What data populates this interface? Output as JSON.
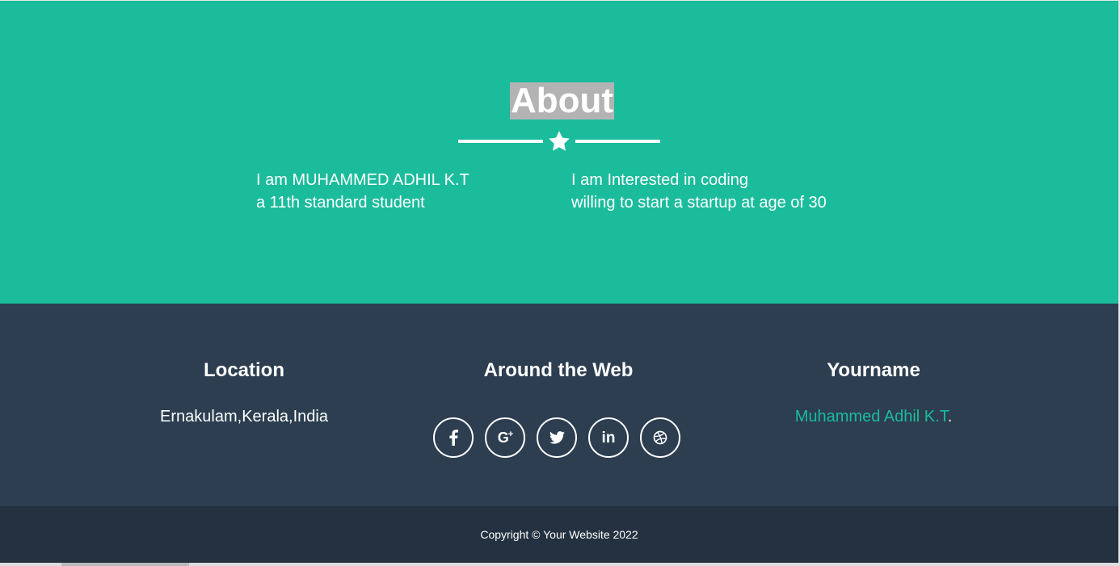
{
  "about": {
    "title": "About",
    "col1": {
      "line1": "I am MUHAMMED ADHIL K.T",
      "line2": "a 11th standard student"
    },
    "col2": {
      "line1": "I am Interested in coding",
      "line2": "willing to start a startup at age of 30"
    },
    "divider_icon": "star-icon"
  },
  "footer": {
    "location": {
      "heading": "Location",
      "text": "Ernakulam,Kerala,India"
    },
    "web": {
      "heading": "Around the Web",
      "socials": [
        "facebook-icon",
        "google-plus-icon",
        "twitter-icon",
        "linkedin-icon",
        "dribbble-icon"
      ]
    },
    "name": {
      "heading": "Yourname",
      "link_text": "Muhammed Adhil K.T",
      "suffix": "."
    },
    "copyright": "Copyright © Your Website 2022"
  },
  "colors": {
    "primary": "#1abc9c",
    "footer_bg": "#2c3e50",
    "footer_bottom_bg": "#233140",
    "title_highlight": "#b3b3b3"
  }
}
